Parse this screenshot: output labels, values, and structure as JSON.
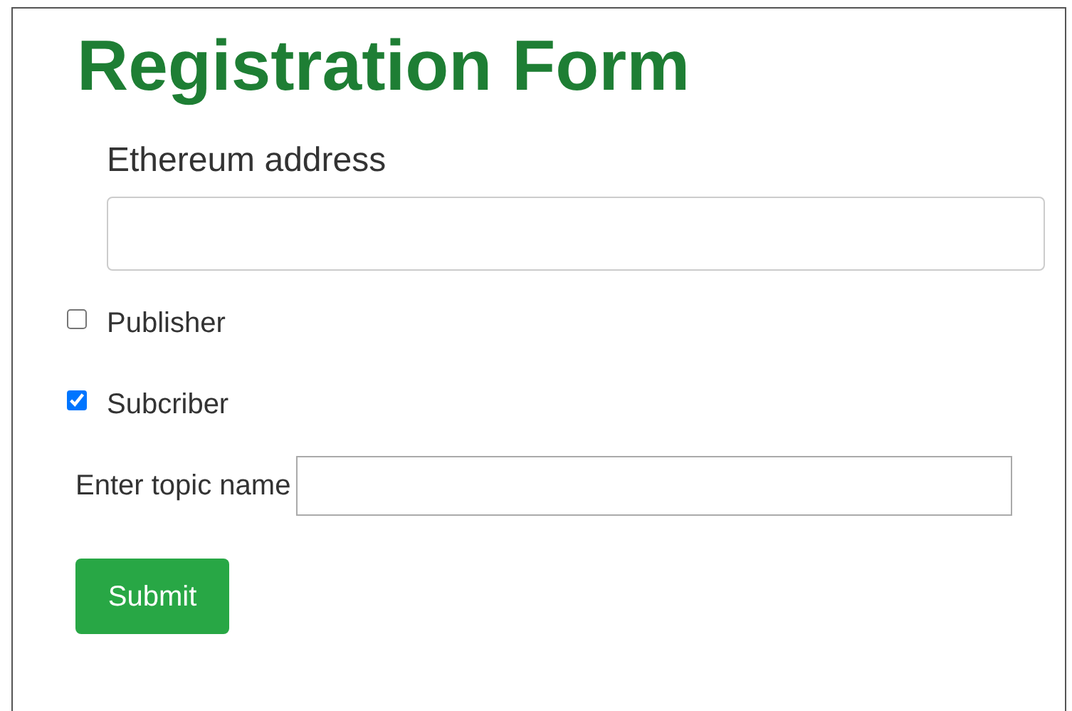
{
  "title": "Registration Form",
  "address_field": {
    "label": "Ethereum address"
  },
  "roles": [
    {
      "label": "Publisher",
      "checked": false
    },
    {
      "label": "Subcriber",
      "checked": true
    }
  ],
  "topic_field": {
    "label": "Enter topic name"
  },
  "submit_button": "Submit"
}
